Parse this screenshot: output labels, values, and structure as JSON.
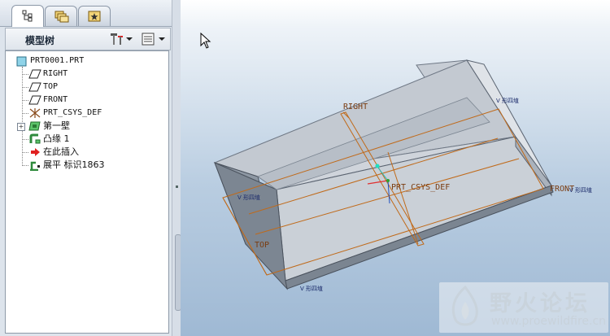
{
  "tabs": [
    {
      "icon": "model-tree-tab-icon"
    },
    {
      "icon": "folder-browser-tab-icon"
    },
    {
      "icon": "favorites-tab-icon"
    }
  ],
  "model_tree": {
    "title": "模型树",
    "settings_icon": "tree-settings-icon",
    "columns_icon": "tree-columns-icon",
    "items": [
      {
        "label": "PRT0001.PRT",
        "icon": "part-icon"
      },
      {
        "label": "RIGHT",
        "icon": "datum-plane-icon"
      },
      {
        "label": "TOP",
        "icon": "datum-plane-icon"
      },
      {
        "label": "FRONT",
        "icon": "datum-plane-icon"
      },
      {
        "label": "PRT_CSYS_DEF",
        "icon": "csys-icon"
      },
      {
        "label": "第一壁",
        "icon": "sheetmetal-wall-icon"
      },
      {
        "label": "凸缘 1",
        "icon": "flange-icon"
      },
      {
        "label": "在此插入",
        "icon": "insert-here-arrow-icon"
      },
      {
        "label": "展平 标识1863",
        "icon": "unbend-icon"
      }
    ]
  },
  "viewport": {
    "labels": {
      "right": "RIGHT",
      "front": "FRONT",
      "top": "TOP",
      "csys": "PRT_CSYS_DEF",
      "v1": "V 形四埴",
      "v2": "V 形四埴",
      "v3": "V 形四埴",
      "v4": "V 形四埴"
    }
  },
  "watermark": {
    "title": "野火论坛",
    "url": "www.proewildfire.cn"
  }
}
